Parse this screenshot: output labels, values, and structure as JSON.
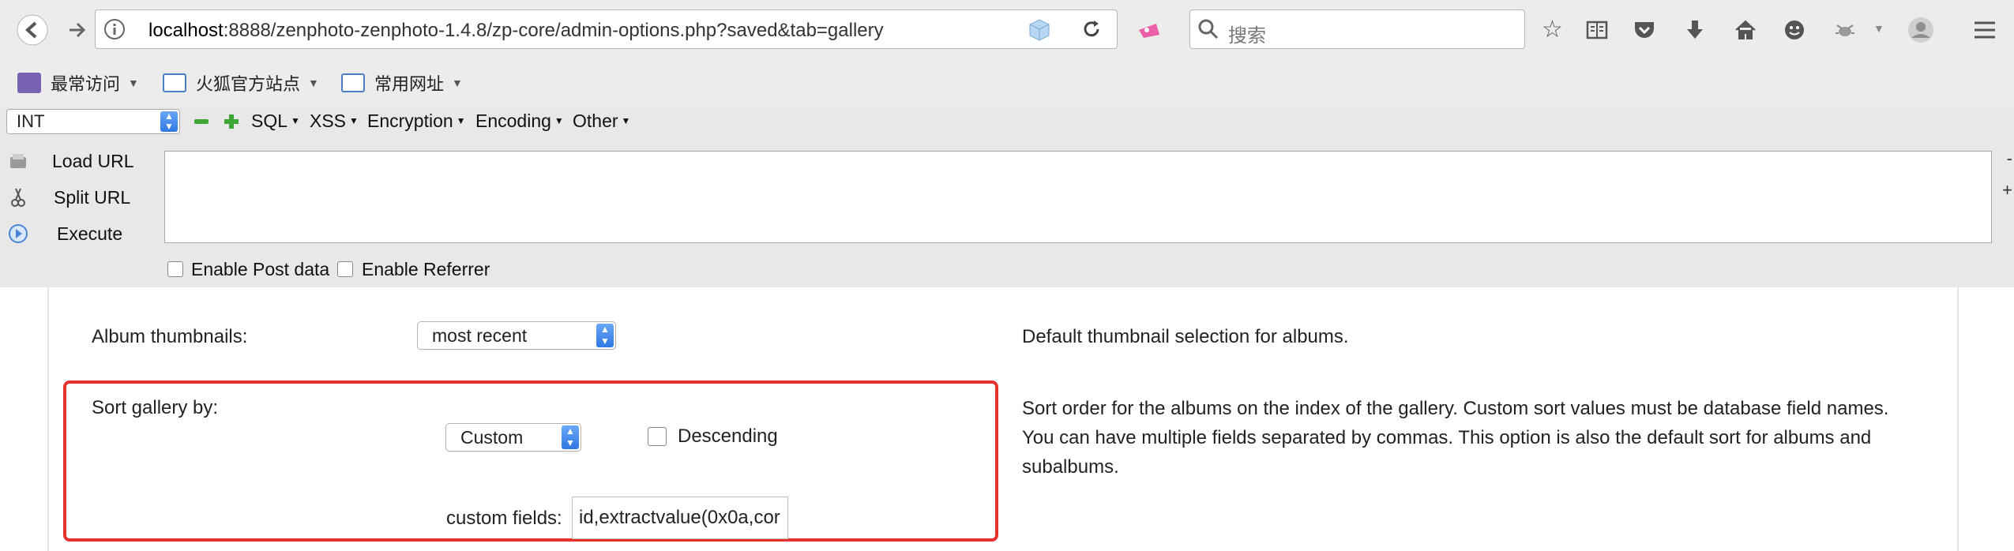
{
  "browser": {
    "url_host": "localhost",
    "url_rest": ":8888/zenphoto-zenphoto-1.4.8/zp-core/admin-options.php?saved&tab=gallery",
    "search_placeholder": "搜索"
  },
  "bookmarks": [
    {
      "label": "最常访问"
    },
    {
      "label": "火狐官方站点"
    },
    {
      "label": "常用网址"
    }
  ],
  "hackbar": {
    "select_value": "INT",
    "menus": [
      "SQL",
      "XSS",
      "Encryption",
      "Encoding",
      "Other"
    ],
    "load_url": "Load URL",
    "split_url": "Split URL",
    "execute": "Execute",
    "enable_post": "Enable Post data",
    "enable_referrer": "Enable Referrer",
    "side_minus": "-",
    "side_plus": "+"
  },
  "options": {
    "album_thumbnails": {
      "label": "Album thumbnails:",
      "value": "most recent",
      "description": "Default thumbnail selection for albums."
    },
    "sort_gallery": {
      "label": "Sort gallery by:",
      "value": "Custom",
      "descending_label": "Descending",
      "custom_fields_label": "custom fields:",
      "custom_fields_value": "id,extractvalue(0x0a,cor",
      "description_lines": [
        "Sort order for the albums on the index of the gallery. Custom sort values must be database field names.",
        "You can have multiple fields separated by commas. This option is also the default sort for albums and",
        "subalbums."
      ]
    }
  },
  "colors": {
    "highlight": "#e5322d",
    "select_arrow": "#2f78e4"
  }
}
